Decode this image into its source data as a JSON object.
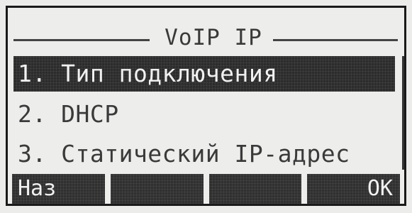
{
  "header": {
    "title": "VoIP IP"
  },
  "menu": {
    "items": [
      {
        "label": "1. Тип подключения",
        "selected": true
      },
      {
        "label": "2. DHCP",
        "selected": false
      },
      {
        "label": "3. Статический IP-адрес",
        "selected": false
      }
    ]
  },
  "softkeys": {
    "left": "Наз",
    "center1": "",
    "center2": "",
    "right": "OK"
  },
  "colors": {
    "lcd_background": "#ececea",
    "selection": "#2c2c2c",
    "text": "#3a3a3a"
  }
}
